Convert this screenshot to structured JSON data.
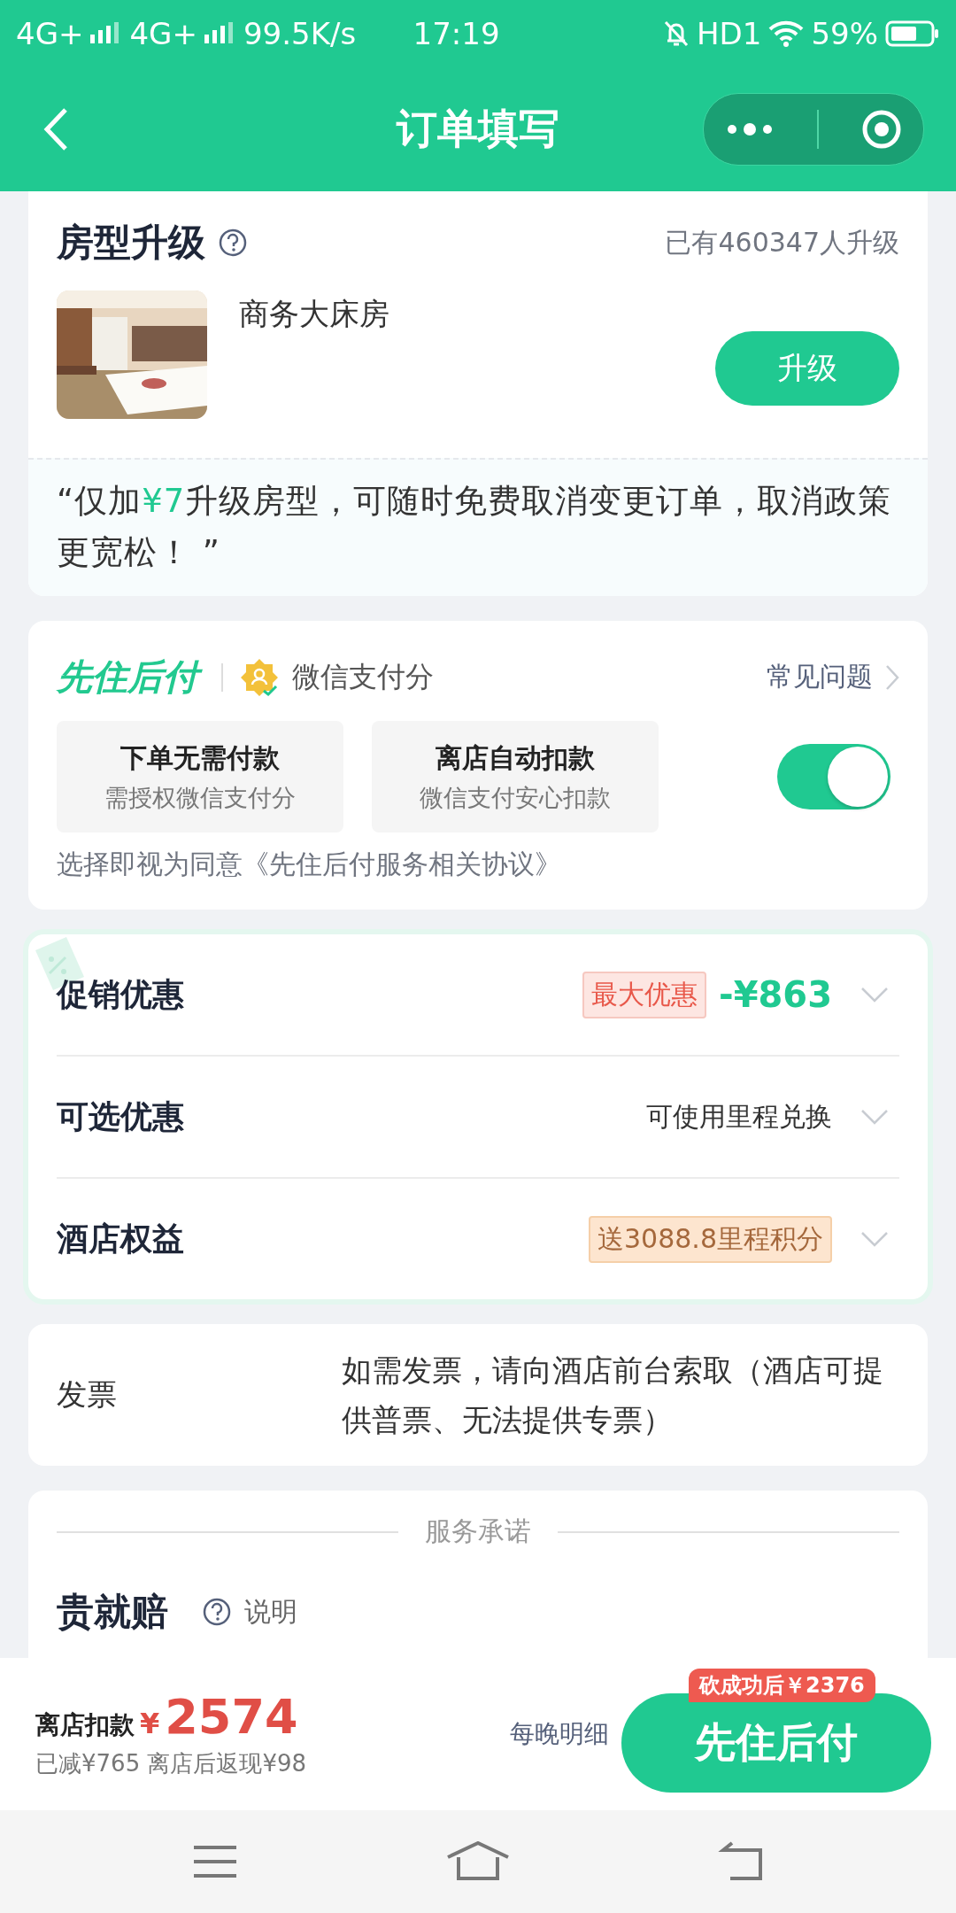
{
  "status_bar": {
    "networks": [
      "4G+",
      "4G+"
    ],
    "speed": "99.5K/s",
    "time": "17:19",
    "hd": "HD1",
    "battery": "59%"
  },
  "header": {
    "title": "订单填写"
  },
  "upgrade": {
    "title": "房型升级",
    "count": "已有460347人升级",
    "room": "商务大床房",
    "button": "升级",
    "note": "“仅加**¥7**升级房型，可随时免费取消变更订单，取消政策更宽松！ ”"
  },
  "pay_later": {
    "brand": "先住后付",
    "partner": "微信支付分",
    "faq": "常见问题",
    "options": [
      {
        "title": "下单无需付款",
        "subtitle": "需授权微信支付分"
      },
      {
        "title": "离店自动扣款",
        "subtitle": "微信支付安心扣款"
      }
    ],
    "toggle": {
      "on": true
    },
    "agreement": "选择即视为同意《先住后付服务相关协议》"
  },
  "discounts": [
    {
      "kind": "promo",
      "label": "促销优惠",
      "tag": "最大优惠",
      "value": "-¥863"
    },
    {
      "kind": "text",
      "label": "可选优惠",
      "value": "可使用里程兑换"
    },
    {
      "kind": "reward",
      "label": "酒店权益",
      "tag": "送3088.8里程积分"
    }
  ],
  "invoice": {
    "label": "发票",
    "text": "如需发票，请向酒店前台索取（酒店可提供普票、无法提供专票）"
  },
  "service": {
    "heading": "服务承诺",
    "title": "贵就赔",
    "help": "说明"
  },
  "bottom_bar": {
    "label": "离店扣款",
    "currency": "¥",
    "amount": "2574",
    "detail": "已减¥765 离店后返现¥98",
    "link": "每晚明细",
    "badge": "砍成功后￥2376",
    "button": "先住后付"
  }
}
